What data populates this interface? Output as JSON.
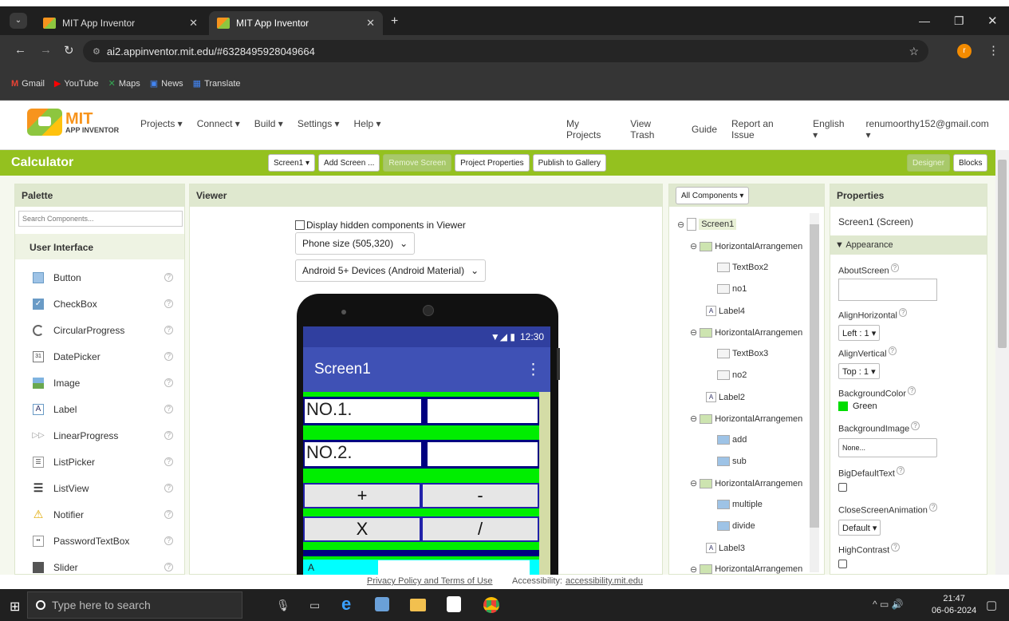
{
  "browser": {
    "tabs": [
      {
        "title": "MIT App Inventor",
        "active": false
      },
      {
        "title": "MIT App Inventor",
        "active": true
      }
    ],
    "new_tab": "+",
    "url": "ai2.appinventor.mit.edu/#6328495928049664",
    "bookmarks": [
      "Gmail",
      "YouTube",
      "Maps",
      "News",
      "Translate"
    ],
    "profile_initial": "r"
  },
  "header": {
    "logo_top": "MIT",
    "logo_bottom": "APP INVENTOR",
    "menus": [
      "Projects ▾",
      "Connect ▾",
      "Build ▾",
      "Settings ▾",
      "Help ▾"
    ],
    "right_links": [
      "My Projects",
      "View Trash",
      "Guide",
      "Report an Issue",
      "English ▾",
      "renumoorthy152@gmail.com ▾"
    ]
  },
  "toolbar": {
    "project_name": "Calculator",
    "screen_select": "Screen1 ▾",
    "buttons": [
      "Add Screen ...",
      "Remove Screen",
      "Project Properties",
      "Publish to Gallery"
    ],
    "designer": "Designer",
    "blocks": "Blocks"
  },
  "palette": {
    "title": "Palette",
    "search_placeholder": "Search Components...",
    "category": "User Interface",
    "items": [
      "Button",
      "CheckBox",
      "CircularProgress",
      "DatePicker",
      "Image",
      "Label",
      "LinearProgress",
      "ListPicker",
      "ListView",
      "Notifier",
      "PasswordTextBox",
      "Slider"
    ],
    "help": "?"
  },
  "viewer": {
    "title": "Viewer",
    "checkbox_label": "Display hidden components in Viewer",
    "phone_size": "Phone size (505,320)",
    "device": "Android 5+ Devices (Android Material)",
    "status_time": "12:30",
    "screen_title": "Screen1",
    "label_no1": "NO.1.",
    "label_no2": "NO.2.",
    "btn_add": "+",
    "btn_sub": "-",
    "btn_mul": "X",
    "btn_div": "/",
    "bottom_partial": "A"
  },
  "components": {
    "dropdown": "All Components ▾",
    "tree": [
      {
        "name": "Screen1",
        "level": 0,
        "toggle": "⊖"
      },
      {
        "name": "HorizontalArrangemen",
        "level": 1,
        "toggle": "⊖"
      },
      {
        "name": "TextBox2",
        "level": 2,
        "toggle": ""
      },
      {
        "name": "no1",
        "level": 2,
        "toggle": ""
      },
      {
        "name": "Label4",
        "level": 1,
        "toggle": ""
      },
      {
        "name": "HorizontalArrangemen",
        "level": 1,
        "toggle": "⊖"
      },
      {
        "name": "TextBox3",
        "level": 2,
        "toggle": ""
      },
      {
        "name": "no2",
        "level": 2,
        "toggle": ""
      },
      {
        "name": "Label2",
        "level": 1,
        "toggle": ""
      },
      {
        "name": "HorizontalArrangemen",
        "level": 1,
        "toggle": "⊖"
      },
      {
        "name": "add",
        "level": 2,
        "toggle": ""
      },
      {
        "name": "sub",
        "level": 2,
        "toggle": ""
      },
      {
        "name": "HorizontalArrangemen",
        "level": 1,
        "toggle": "⊖"
      },
      {
        "name": "multiple",
        "level": 2,
        "toggle": ""
      },
      {
        "name": "divide",
        "level": 2,
        "toggle": ""
      },
      {
        "name": "Label3",
        "level": 1,
        "toggle": ""
      },
      {
        "name": "HorizontalArrangemen",
        "level": 1,
        "toggle": "⊖"
      }
    ]
  },
  "properties": {
    "title": "Properties",
    "subtitle": "Screen1 (Screen)",
    "section": "▼ Appearance",
    "about_label": "AboutScreen",
    "align_h_label": "AlignHorizontal",
    "align_h_value": "Left : 1 ▾",
    "align_v_label": "AlignVertical",
    "align_v_value": "Top : 1 ▾",
    "bgcolor_label": "BackgroundColor",
    "bgcolor_value": "Green",
    "bgimage_label": "BackgroundImage",
    "bgimage_value": "None...",
    "bigtext_label": "BigDefaultText",
    "close_anim_label": "CloseScreenAnimation",
    "close_anim_value": "Default ▾",
    "contrast_label": "HighContrast",
    "help": "?"
  },
  "footer": {
    "privacy": "Privacy Policy and Terms of Use",
    "access_prefix": "Accessibility:",
    "access_link": "accessibility.mit.edu"
  },
  "taskbar": {
    "search_placeholder": "Type here to search",
    "time": "21:47",
    "date": "06-06-2024"
  },
  "colors": {
    "accent": "#94c11f",
    "panel_head": "#dfe8cf",
    "phone_green": "#00ee00",
    "phone_blue": "#3f51b5"
  }
}
